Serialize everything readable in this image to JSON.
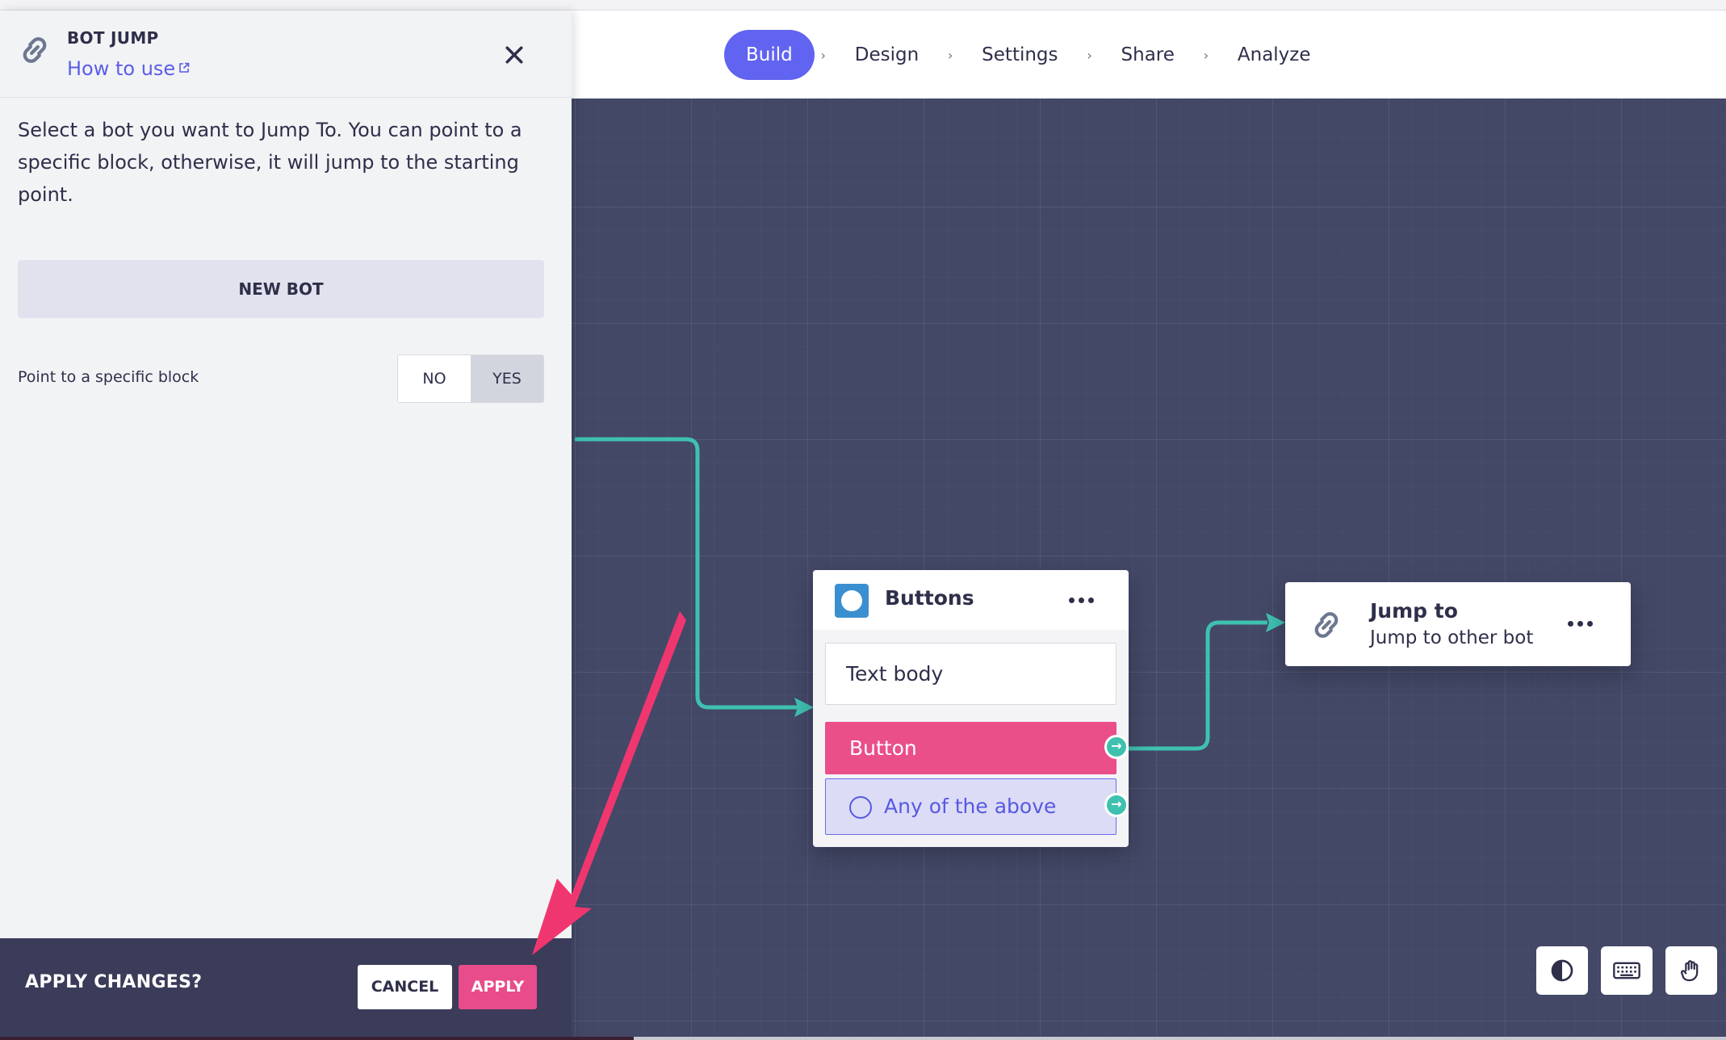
{
  "nav": {
    "steps": [
      {
        "label": "Build",
        "active": true
      },
      {
        "label": "Design"
      },
      {
        "label": "Settings"
      },
      {
        "label": "Share"
      },
      {
        "label": "Analyze"
      }
    ],
    "separator": "›"
  },
  "panel": {
    "kicker": "BOT JUMP",
    "howto": "How to use",
    "description": "Select a bot you want to Jump To. You can point to a specific block, otherwise, it will jump to the starting point.",
    "new_bot": "NEW BOT",
    "point_label": "Point to a specific block",
    "toggle_no": "NO",
    "toggle_yes": "YES",
    "toggle_selected": "NO"
  },
  "applybar": {
    "question": "APPLY CHANGES?",
    "cancel": "CANCEL",
    "apply": "APPLY"
  },
  "canvas": {
    "buttons_node": {
      "title": "Buttons",
      "text_body": "Text body",
      "button": "Button",
      "any": "Any of the above",
      "any_icon": "?"
    },
    "jump_node": {
      "title": "Jump to",
      "subtitle": "Jump to other bot"
    },
    "port_arrow": "→",
    "tools": [
      "contrast-icon",
      "keyboard-icon",
      "hand-icon"
    ]
  },
  "colors": {
    "accent": "#6163f1",
    "pink": "#ea4f8a",
    "canvas": "#434867",
    "wire": "#3fc1b0",
    "annotation_arrow": "#f0366f"
  }
}
